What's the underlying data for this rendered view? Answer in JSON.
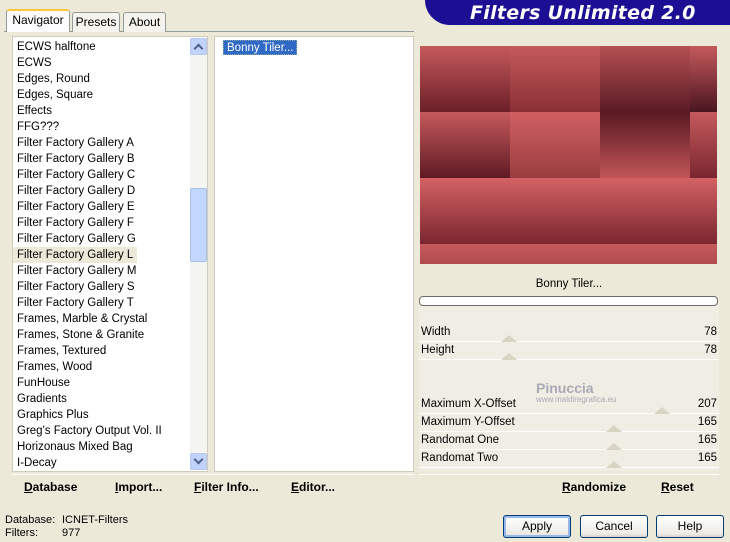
{
  "tabs": [
    {
      "label": "Navigator",
      "active": true
    },
    {
      "label": "Presets",
      "active": false
    },
    {
      "label": "About",
      "active": false
    }
  ],
  "banner": {
    "title": "Filters Unlimited 2.0",
    "color": "#1c0f93"
  },
  "categories": {
    "items": [
      "ECWS halftone",
      "ECWS",
      "Edges, Round",
      "Edges, Square",
      "Effects",
      "FFG???",
      "Filter Factory Gallery A",
      "Filter Factory Gallery B",
      "Filter Factory Gallery C",
      "Filter Factory Gallery D",
      "Filter Factory Gallery E",
      "Filter Factory Gallery F",
      "Filter Factory Gallery G",
      "Filter Factory Gallery L",
      "Filter Factory Gallery M",
      "Filter Factory Gallery S",
      "Filter Factory Gallery T",
      "Frames, Marble & Crystal",
      "Frames, Stone & Granite",
      "Frames, Textured",
      "Frames, Wood",
      "FunHouse",
      "Gradients",
      "Graphics Plus",
      "Greg's Factory Output Vol. II",
      "Horizonaus Mixed Bag",
      "I-Decay"
    ],
    "selected": "Filter Factory Gallery L"
  },
  "filters": {
    "items": [
      "Bonny Tiler..."
    ],
    "selected": "Bonny Tiler..."
  },
  "preview": {
    "filter_name": "Bonny Tiler..."
  },
  "params": [
    {
      "label": "Width",
      "value": "78",
      "level": 0.3
    },
    {
      "label": "Height",
      "value": "78",
      "level": 0.3
    },
    {
      "label": "Maximum X-Offset",
      "value": "207",
      "level": 0.81
    },
    {
      "label": "Maximum Y-Offset",
      "value": "165",
      "level": 0.65
    },
    {
      "label": "Randomat One",
      "value": "165",
      "level": 0.65
    },
    {
      "label": "Randomat Two",
      "value": "165",
      "level": 0.65
    }
  ],
  "watermark": {
    "title": "Pinuccia",
    "url": "www.maldiregrafica.eu"
  },
  "left_actions": {
    "database": "Database",
    "import": "Import...",
    "filter_info": "Filter Info...",
    "editor": "Editor..."
  },
  "right_actions": {
    "randomize": "Randomize",
    "reset": "Reset"
  },
  "status": {
    "database_label": "Database:",
    "database_value": "ICNET-Filters",
    "filters_label": "Filters:",
    "filters_value": "977"
  },
  "buttons": {
    "apply": "Apply",
    "cancel": "Cancel",
    "help": "Help"
  }
}
